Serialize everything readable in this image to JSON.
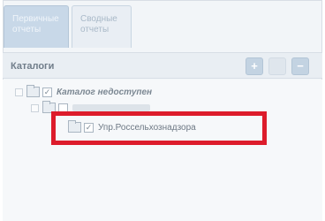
{
  "tabs": [
    {
      "label": "Первичные\nотчеты",
      "active": true
    },
    {
      "label": "Сводные\nотчеты",
      "active": false
    }
  ],
  "catalog_panel": {
    "title": "Каталоги",
    "buttons": [
      {
        "icon": "plus-icon",
        "glyph": "+"
      },
      {
        "icon": "edit-icon",
        "glyph": ""
      },
      {
        "icon": "minus-icon",
        "glyph": "−"
      }
    ]
  },
  "tree": {
    "root": {
      "label": "Каталог недоступен",
      "checked": true
    },
    "leaf": {
      "label": "Упр.Россельхознадзора",
      "checked": true
    }
  },
  "colors": {
    "highlight": "#dd1c2b",
    "accent": "#c3d3e2"
  }
}
